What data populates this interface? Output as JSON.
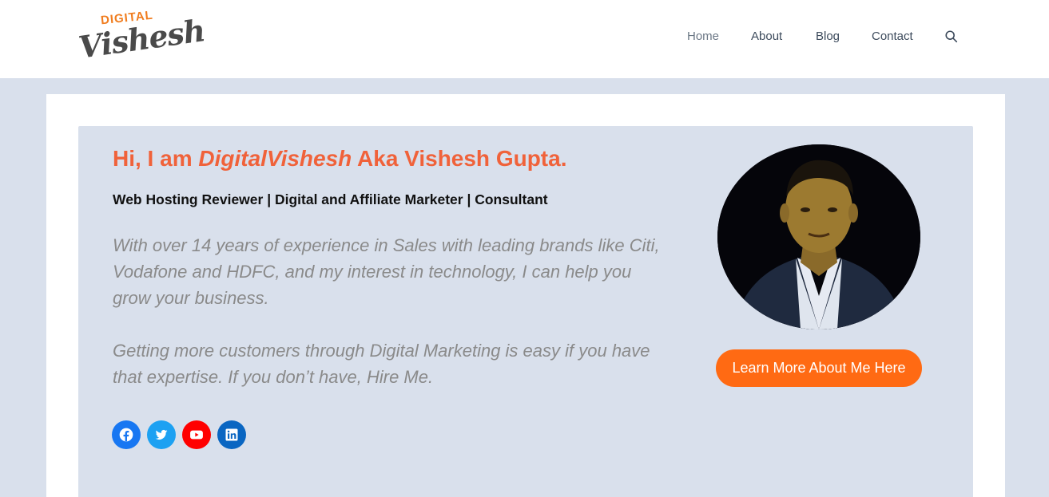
{
  "logo": {
    "top_text": "DIGITAL",
    "main_text": "Vishesh"
  },
  "nav": {
    "items": [
      {
        "label": "Home"
      },
      {
        "label": "About"
      },
      {
        "label": "Blog"
      },
      {
        "label": "Contact"
      }
    ],
    "search_icon": "search-icon"
  },
  "hero": {
    "title_prefix": "Hi, I am ",
    "title_brand": "DigitalVishesh",
    "title_suffix": " Aka Vishesh Gupta.",
    "subtitle": "Web Hosting Reviewer | Digital and Affiliate Marketer | Consultant",
    "paragraph1": "With over 14 years of experience in Sales with leading brands like Citi, Vodafone and HDFC, and my interest in technology, I can help you grow your business.",
    "paragraph2": "Getting more customers through Digital Marketing is easy if you have that expertise. If you don’t have, Hire Me.",
    "cta_label": "Learn More About Me Here"
  },
  "socials": [
    {
      "icon": "facebook-icon",
      "color": "#1877f2"
    },
    {
      "icon": "twitter-icon",
      "color": "#1da1f2"
    },
    {
      "icon": "youtube-icon",
      "color": "#ff0000"
    },
    {
      "icon": "linkedin-icon",
      "color": "#0a66c2"
    }
  ],
  "colors": {
    "accent": "#f0623a",
    "cta": "#ff6a13",
    "background": "#d9e0ec"
  }
}
